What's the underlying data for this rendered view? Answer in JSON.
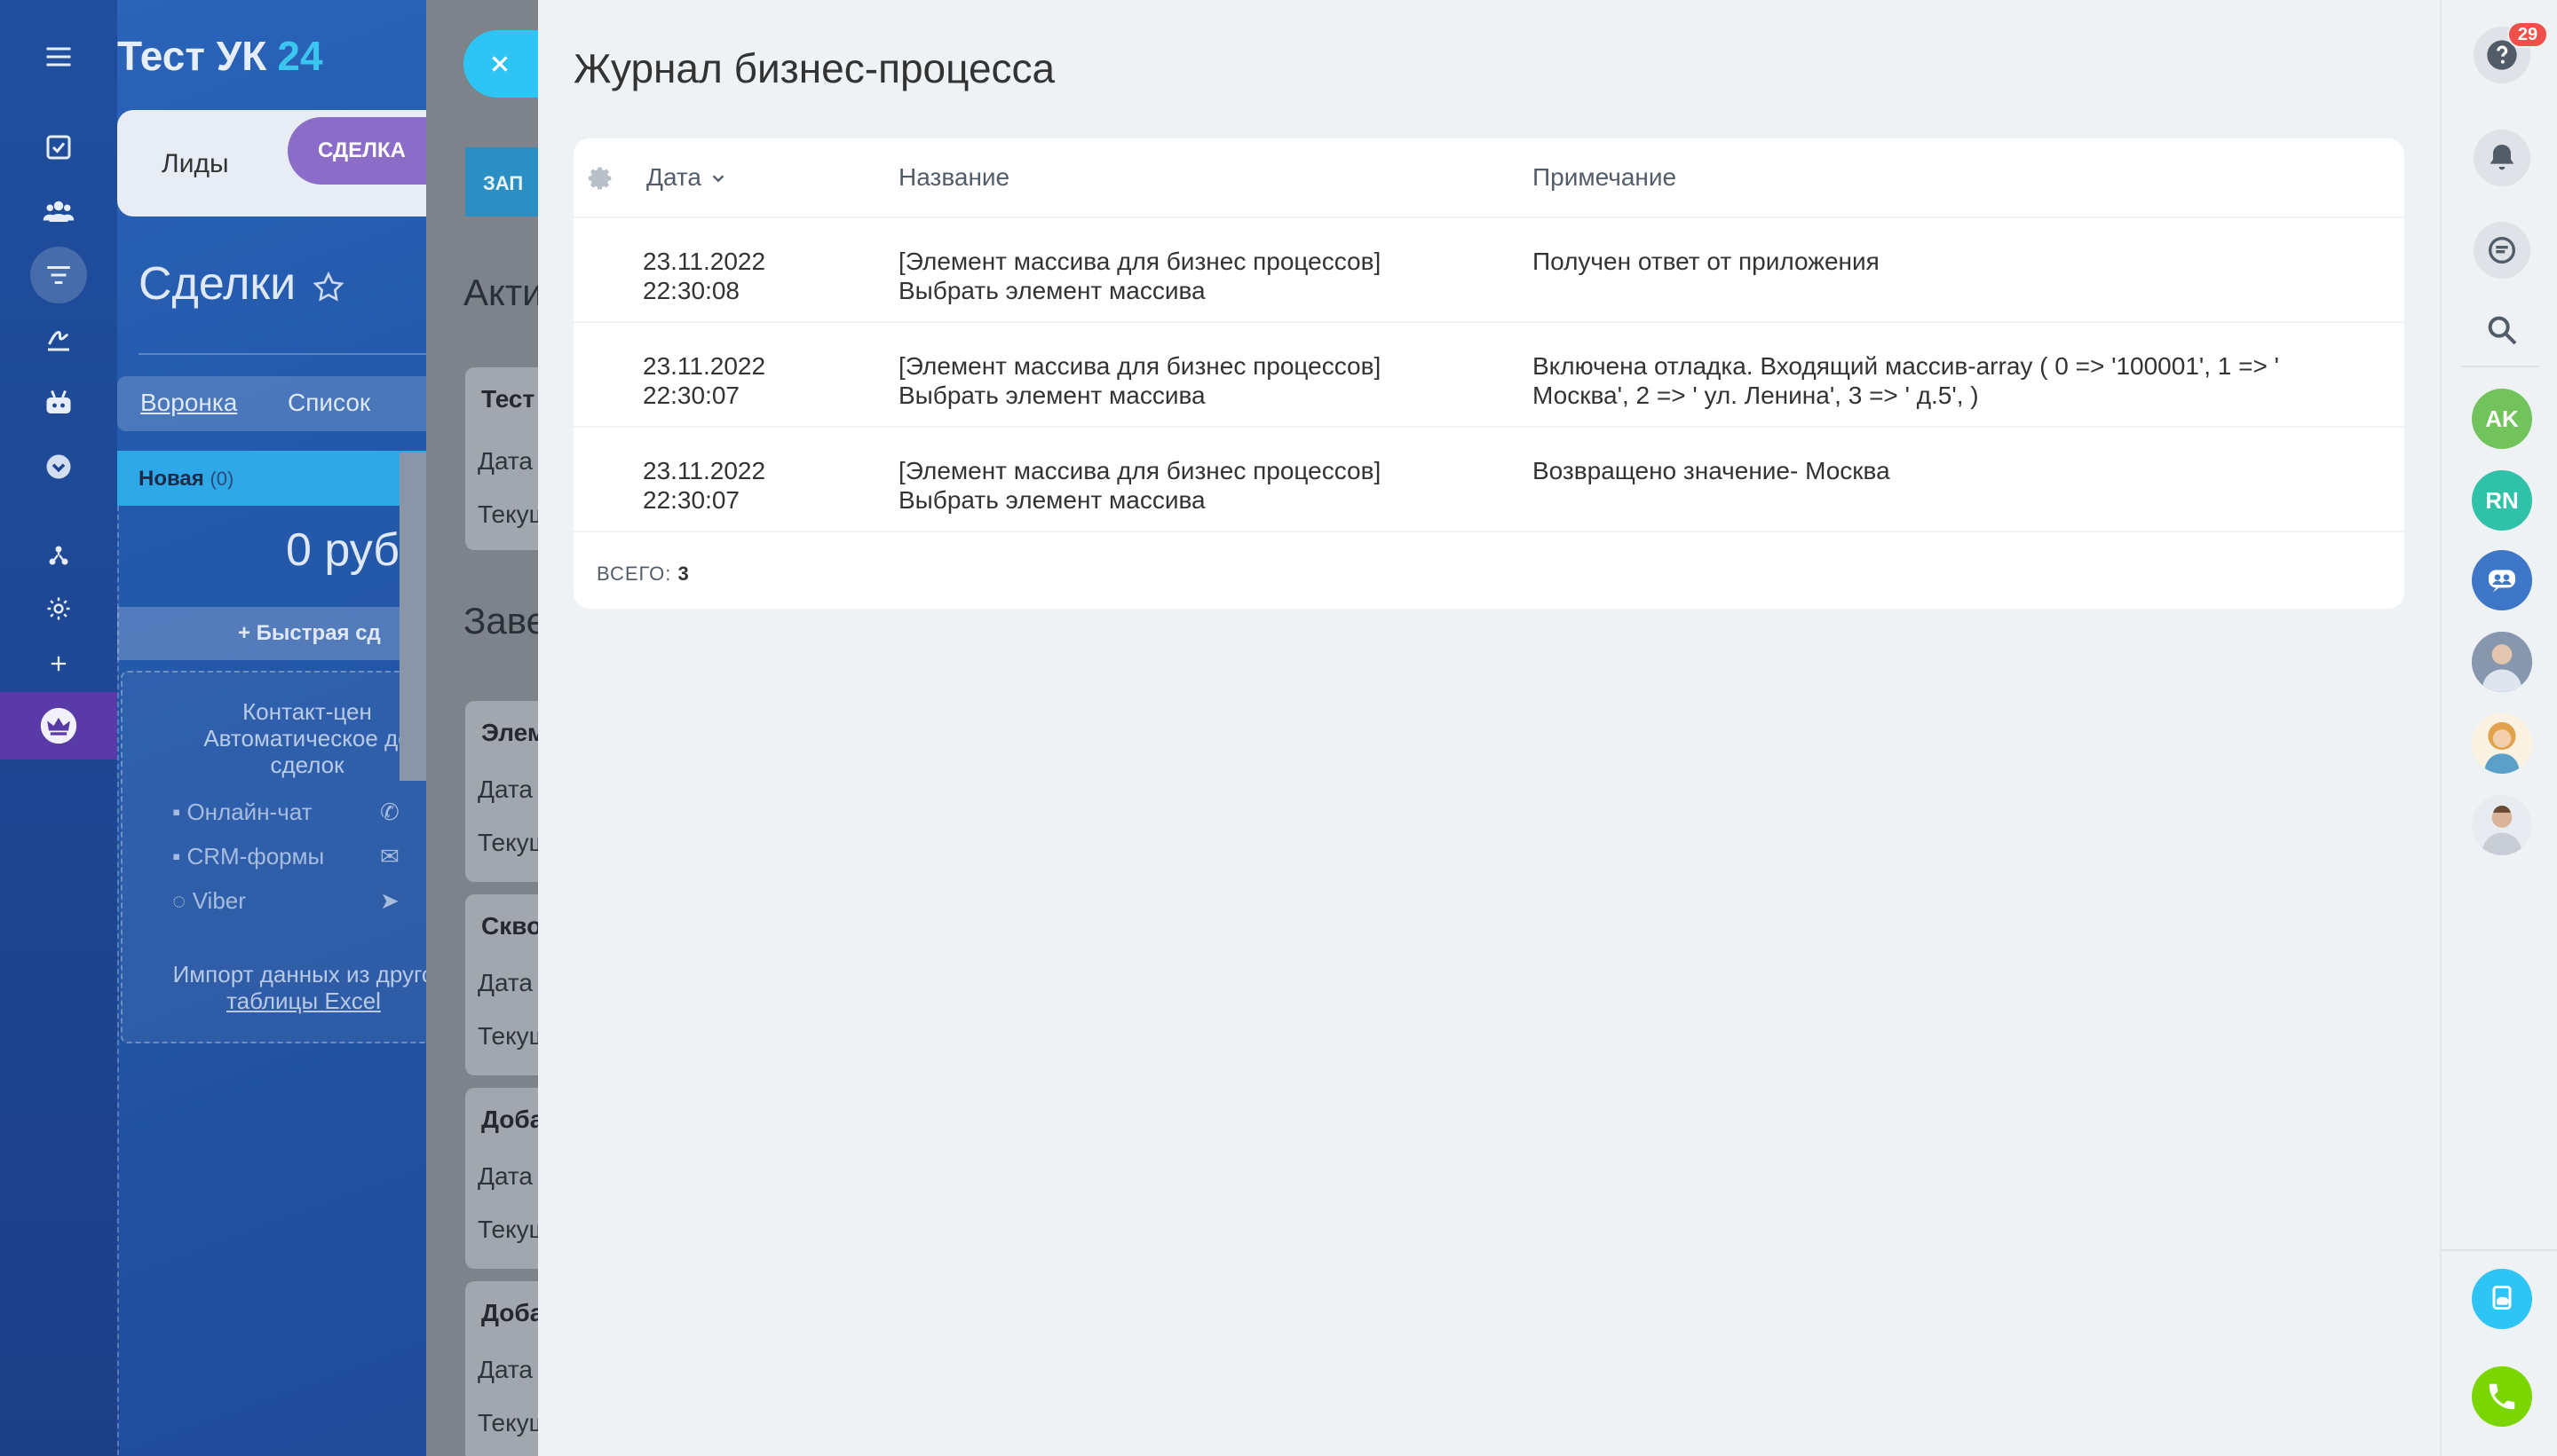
{
  "portal": {
    "name": "Тест УК",
    "suffix": "24"
  },
  "crm_tabs": {
    "leads": "Лиды",
    "deal": "СДЕЛКА"
  },
  "deals_page": {
    "title": "Сделки",
    "views": [
      "Воронка",
      "Список"
    ],
    "stage": {
      "name": "Новая",
      "count": "(0)"
    },
    "sum": "0 руб",
    "quick_deal": "+ Быстрая сд",
    "empty_card": {
      "text": [
        "Контакт-цен",
        "Автоматическое до",
        "сделок"
      ]
    },
    "channels": [
      "Онлайн-чат",
      "CRM-формы",
      "Viber"
    ],
    "import_text": [
      "Импорт данных из друго",
      "таблицы Excel"
    ]
  },
  "underlay": {
    "button": "ЗАП",
    "heading_active": "Акти",
    "heading_done": "Заве",
    "blocks": [
      {
        "title": "Тест",
        "rows": [
          "Дата",
          "Текущ"
        ]
      },
      {
        "title": "Элем",
        "rows": [
          "Дата",
          "Текущ"
        ]
      },
      {
        "title": "Скво",
        "rows": [
          "Дата",
          "Текущ"
        ]
      },
      {
        "title": "Доба",
        "rows": [
          "Дата",
          "Текущ"
        ]
      },
      {
        "title": "Доба",
        "rows": [
          "Дата",
          "Текущ"
        ]
      }
    ]
  },
  "slider": {
    "title": "Журнал бизнес-процесса",
    "columns": {
      "date": "Дата",
      "name": "Название",
      "note": "Примечание"
    },
    "rows": [
      {
        "date": "23.11.2022",
        "time": "22:30:08",
        "name_line1": "[Элемент массива для бизнес процессов]",
        "name_line2": "Выбрать элемент массива",
        "note_line1": "Получен ответ от приложения",
        "note_line2": ""
      },
      {
        "date": "23.11.2022",
        "time": "22:30:07",
        "name_line1": "[Элемент массива для бизнес процессов]",
        "name_line2": "Выбрать элемент массива",
        "note_line1": "Включена отладка. Входящий массив-array ( 0 => '100001', 1 => '",
        "note_line2": "Москва', 2 => ' ул. Ленина', 3 => ' д.5', )"
      },
      {
        "date": "23.11.2022",
        "time": "22:30:07",
        "name_line1": "[Элемент массива для бизнес процессов]",
        "name_line2": "Выбрать элемент массива",
        "note_line1": "Возвращено значение- Москва",
        "note_line2": ""
      }
    ],
    "total_label": "ВСЕГО:",
    "total_value": "3"
  },
  "right_bar": {
    "help_badge": "29",
    "avatars": [
      {
        "initials": "AK",
        "color": "#72c35b"
      },
      {
        "initials": "RN",
        "color": "#2fc2a8"
      }
    ],
    "call_color": "#7bd500",
    "cloud_color": "#2ec4f4"
  }
}
